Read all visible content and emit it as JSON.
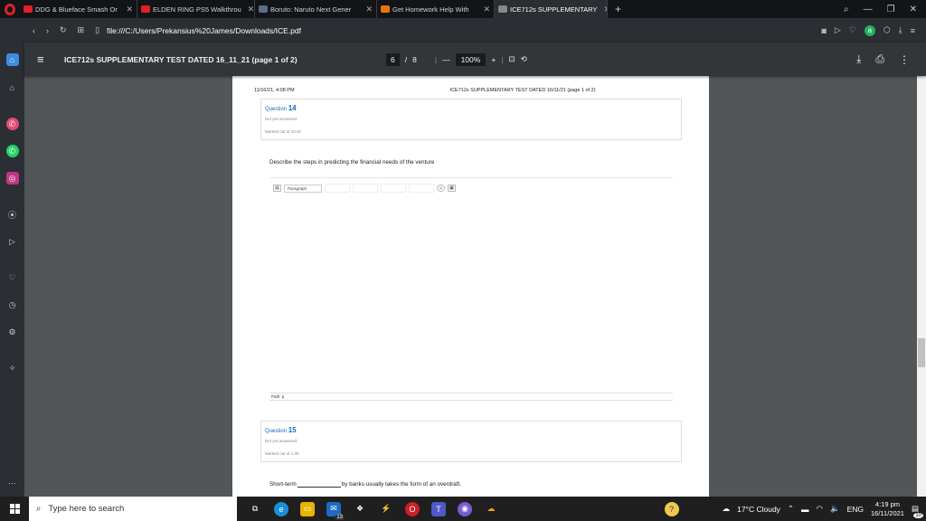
{
  "tabs": [
    {
      "label": "DDG & Blueface Smash Or",
      "color": "#e21f26",
      "active": false
    },
    {
      "label": "ELDEN RING PS5 Walkthrou",
      "color": "#e21f26",
      "active": false
    },
    {
      "label": "Boruto: Naruto Next Gener",
      "color": "#5a6e8c",
      "active": false
    },
    {
      "label": "Get Homework Help With",
      "color": "#e8750a",
      "active": false
    },
    {
      "label": "ICE712s SUPPLEMENTARY",
      "color": "#888",
      "active": true
    }
  ],
  "address": {
    "url": "file:///C:/Users/Prekansius%20James/Downloads/ICE.pdf"
  },
  "pdf": {
    "title": "ICE712s SUPPLEMENTARY TEST DATED 16_11_21 (page 1 of 2)",
    "page_current": "6",
    "page_separator": "/",
    "page_total": "8",
    "zoom": "100%"
  },
  "page": {
    "header_left": "11/16/21, 4:08 PM",
    "header_right": "ICE712s SUPPLEMENTARY TEST DATED 16/11/21 (page 1 of 2)",
    "q14": {
      "label": "Question",
      "num": "14",
      "status": "Not yet answered",
      "marks": "Marked out of 10.00"
    },
    "q14_text": "Describe the steps in predicting the financial needs of the venture",
    "editor_format": "Paragraph",
    "path_text": "Path: p",
    "q15": {
      "label": "Question",
      "num": "15",
      "status": "Not yet answered",
      "marks": "Marked out of 1.00"
    },
    "q15_text_a": "Short-term",
    "q15_text_b": "by banks usually takes the form of an overdraft."
  },
  "taskbar": {
    "search_placeholder": "Type here to search",
    "mail_badge": "13",
    "weather": "17°C  Cloudy",
    "lang": "ENG",
    "time": "4:19 pm",
    "date": "16/11/2021",
    "notif_count": "10"
  }
}
